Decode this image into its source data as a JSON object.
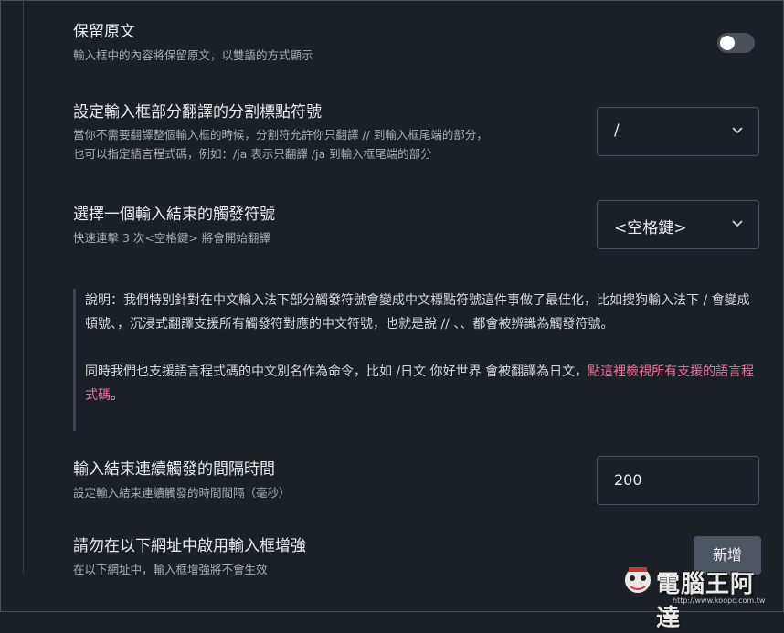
{
  "settings": {
    "keep_original": {
      "title": "保留原文",
      "desc": "輸入框中的內容將保留原文，以雙語的方式顯示",
      "enabled": false
    },
    "split_symbol": {
      "title": "設定輸入框部分翻譯的分割標點符號",
      "desc_line1": "當你不需要翻譯整個輸入框的時候，分割符允許你只翻譯 // 到輸入框尾端的部分，",
      "desc_line2": "也可以指定語言程式碼，例如：/ja 表示只翻譯 /ja 到輸入框尾端的部分",
      "value": "/"
    },
    "trigger_symbol": {
      "title": "選擇一個輸入結束的觸發符號",
      "desc": "快速連擊 3 次<空格鍵> 將會開始翻譯",
      "value": "<空格鍵>"
    },
    "interval": {
      "title": "輸入結束連續觸發的間隔時間",
      "desc": "設定輸入結束連續觸發的時間間隔（毫秒）",
      "value": "200"
    },
    "disable_sites": {
      "title": "請勿在以下網址中啟用輸入框增強",
      "desc": "在以下網址中，輸入框增強將不會生效",
      "add_button": "新增"
    }
  },
  "note": {
    "para1": "說明：我們特別針對在中文輸入法下部分觸發符號會變成中文標點符號這件事做了最佳化，比如搜狗輸入法下 / 會變成頓號、，沉浸式翻譯支援所有觸發符對應的中文符號，也就是說 // 、、都會被辨識為觸發符號。",
    "para2_text": "同時我們也支援語言程式碼的中文別名作為命令，比如 /日文 你好世界 會被翻譯為日文，",
    "para2_link": "點這裡檢視所有支援的語言程式碼",
    "para2_end": "。"
  },
  "watermark": {
    "brand": "電腦王阿達",
    "site": "http://www.koopc.com.tw"
  },
  "colors": {
    "background": "#1b2027",
    "link": "#ef6f96",
    "button": "#4d5560"
  }
}
